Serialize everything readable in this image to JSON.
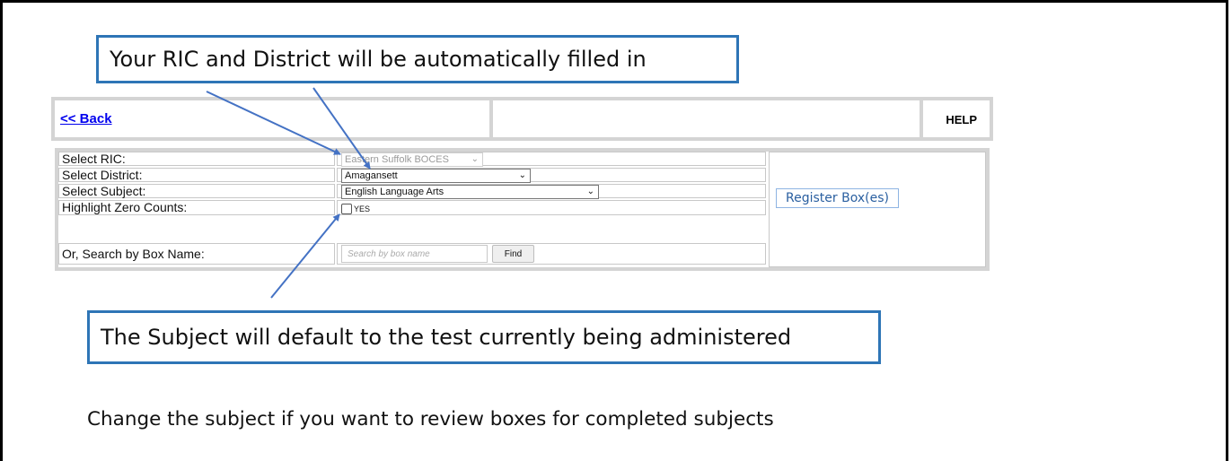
{
  "callouts": {
    "top": "Your RIC and District will be automatically filled in",
    "bottom": "The Subject will default to the test currently being  administered",
    "footnote": "Change the subject if you want to review boxes for completed subjects"
  },
  "topbar": {
    "back_link": "<< Back",
    "help": "HELP"
  },
  "form": {
    "rows": [
      {
        "label": "Select RIC:"
      },
      {
        "label": "Select District:"
      },
      {
        "label": "Select Subject:"
      },
      {
        "label": "Highlight Zero Counts:"
      },
      {
        "label": "Or, Search by Box Name:"
      }
    ],
    "ric_value": "Eastern Suffolk BOCES",
    "district_value": "Amagansett",
    "subject_value": "English Language Arts",
    "zero_counts_option": "YES",
    "search_placeholder": "Search by box name",
    "find_label": "Find",
    "register_label": "Register Box(es)"
  },
  "colors": {
    "callout_border": "#2e75b6",
    "arrow": "#4472c4",
    "link": "#0000ee"
  },
  "icons": {
    "dropdown": "chevron-down-icon",
    "arrow": "arrow-annotation-icon"
  }
}
